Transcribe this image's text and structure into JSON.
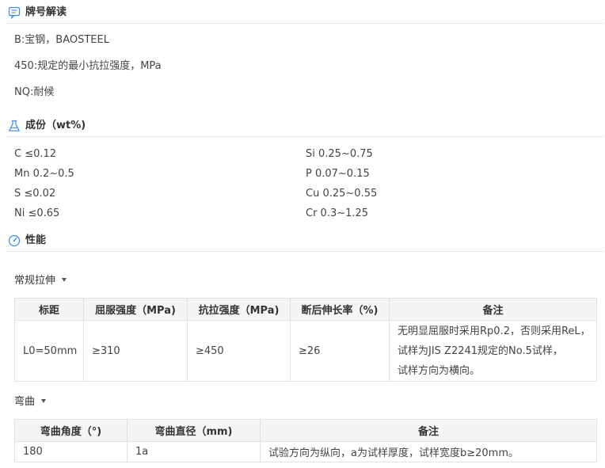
{
  "sections": {
    "grade": {
      "title": "牌号解读",
      "icon": "comment-box-icon"
    },
    "composition": {
      "title": "成份（wt%)",
      "icon": "flask-icon"
    },
    "properties": {
      "title": "性能",
      "icon": "gauge-icon"
    }
  },
  "grade_lines": [
    "B:宝钢，BAOSTEEL",
    "450:规定的最小抗拉强度，MPa",
    "NQ:耐候"
  ],
  "composition": {
    "left": [
      "C ≤0.12",
      "Mn 0.2~0.5",
      "S ≤0.02",
      "Ni ≤0.65"
    ],
    "right": [
      "Si 0.25~0.75",
      "P 0.07~0.15",
      "Cu 0.25~0.55",
      "Cr 0.3~1.25"
    ]
  },
  "tensile": {
    "label": "常规拉伸",
    "headers": [
      "标距",
      "屈服强度（MPa)",
      "抗拉强度（MPa)",
      "断后伸长率（%)",
      "备注"
    ],
    "row": {
      "gauge": "L0=50mm",
      "yield": "≥310",
      "tensile": "≥450",
      "elongation": "≥26",
      "note": [
        "无明显屈服时采用Rp0.2，否则采用ReL，",
        "试样为JIS Z2241规定的No.5试样，",
        "试样方向为横向。"
      ]
    }
  },
  "bending": {
    "label": "弯曲",
    "headers": [
      "弯曲角度（°)",
      "弯曲直径（mm)",
      "备注"
    ],
    "row": {
      "angle": "180",
      "diameter": "1a",
      "note": "试验方向为纵向，a为试样厚度，试样宽度b≥20mm。"
    }
  }
}
